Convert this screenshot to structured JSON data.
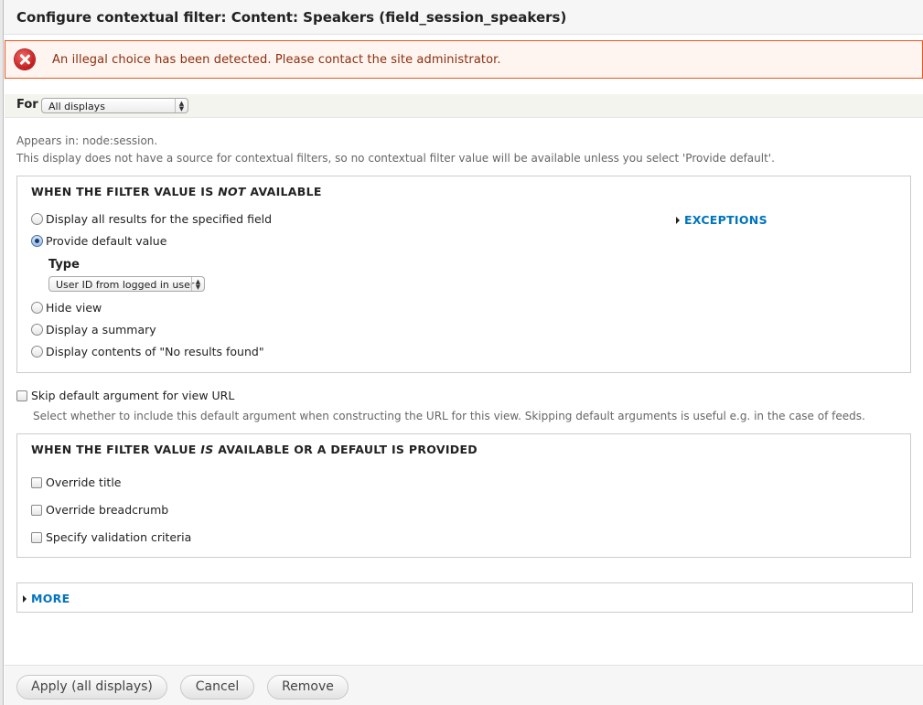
{
  "dialog": {
    "title": "Configure contextual filter: Content: Speakers (field_session_speakers)"
  },
  "error": {
    "message": "An illegal choice has been detected. Please contact the site administrator."
  },
  "for_bar": {
    "label": "For",
    "select_value": "All displays"
  },
  "info": {
    "appears_in": "Appears in: node:session.",
    "notice": "This display does not have a source for contextual filters, so no contextual filter value will be available unless you select 'Provide default'."
  },
  "not_available": {
    "legend_prefix": "WHEN THE FILTER VALUE IS ",
    "legend_emph": "NOT",
    "legend_suffix": " AVAILABLE",
    "options": [
      {
        "label": "Display all results for the specified field",
        "checked": false
      },
      {
        "label": "Provide default value",
        "checked": true
      },
      {
        "label": "Hide view",
        "checked": false
      },
      {
        "label": "Display a summary",
        "checked": false
      },
      {
        "label": "Display contents of \"No results found\"",
        "checked": false
      }
    ],
    "type_label": "Type",
    "type_value": "User ID from logged in user",
    "exceptions_label": "EXCEPTIONS"
  },
  "skip_default": {
    "label": "Skip default argument for view URL",
    "description": "Select whether to include this default argument when constructing the URL for this view. Skipping default arguments is useful e.g. in the case of feeds."
  },
  "is_available": {
    "legend_prefix": "WHEN THE FILTER VALUE ",
    "legend_emph": "IS",
    "legend_suffix": " AVAILABLE OR A DEFAULT IS PROVIDED",
    "checkboxes": [
      {
        "label": "Override title"
      },
      {
        "label": "Override breadcrumb"
      },
      {
        "label": "Specify validation criteria"
      }
    ]
  },
  "more": {
    "label": "MORE"
  },
  "footer": {
    "apply_label": "Apply (all displays)",
    "cancel_label": "Cancel",
    "remove_label": "Remove"
  },
  "colors": {
    "error_border": "#ed541d",
    "error_text": "#8c2e0b",
    "link": "#0074bd"
  }
}
